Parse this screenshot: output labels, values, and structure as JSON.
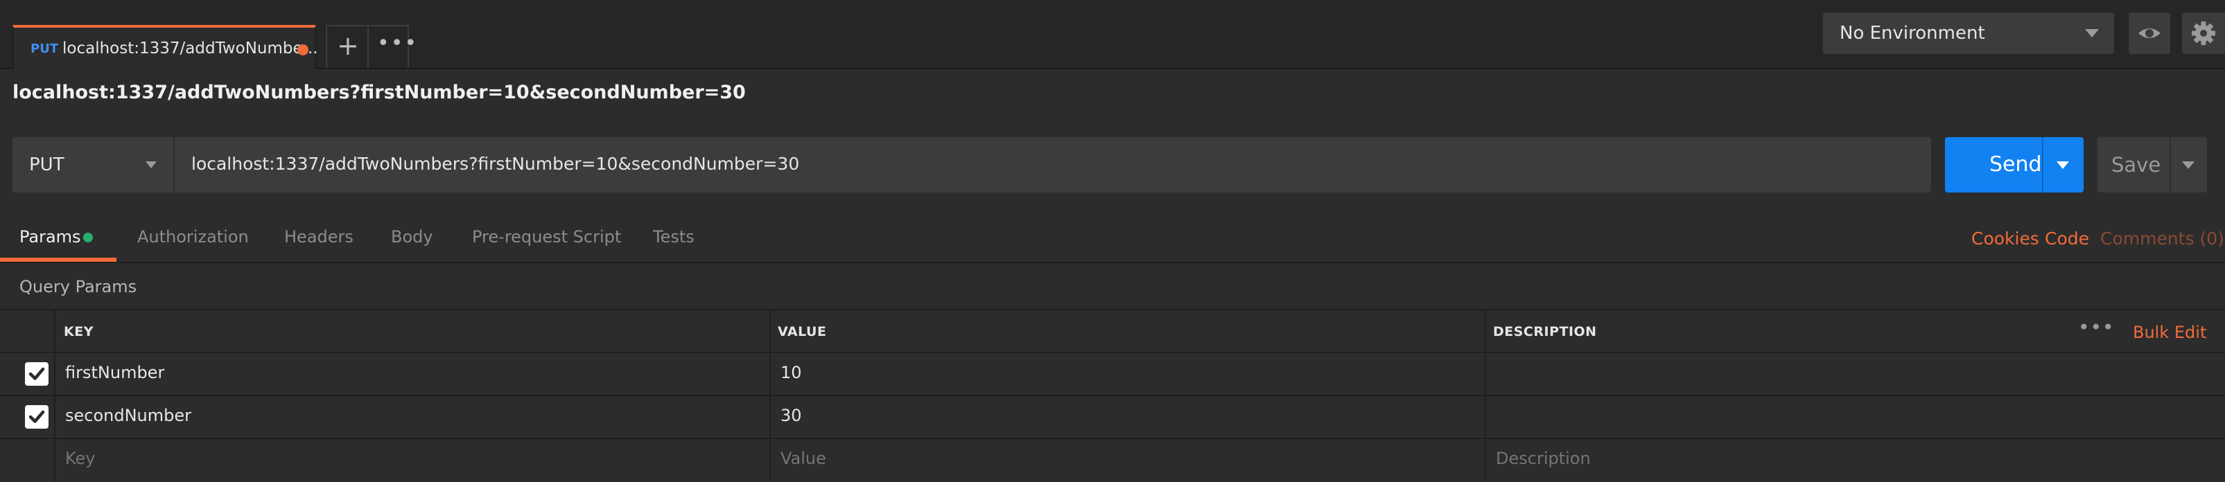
{
  "tab": {
    "method": "PUT",
    "title": "localhost:1337/addTwoNumbe..."
  },
  "environment": {
    "selected": "No Environment"
  },
  "request": {
    "title": "localhost:1337/addTwoNumbers?firstNumber=10&secondNumber=30",
    "method": "PUT",
    "url": "localhost:1337/addTwoNumbers?firstNumber=10&secondNumber=30",
    "send_label": "Send",
    "save_label": "Save"
  },
  "section_tabs": [
    {
      "label": "Params",
      "active": true
    },
    {
      "label": "Authorization"
    },
    {
      "label": "Headers"
    },
    {
      "label": "Body"
    },
    {
      "label": "Pre-request Script"
    },
    {
      "label": "Tests"
    }
  ],
  "right_links": {
    "cookies": "Cookies",
    "code": "Code",
    "comments": "Comments (0)"
  },
  "query_params": {
    "label": "Query Params",
    "headers": {
      "key": "KEY",
      "value": "VALUE",
      "description": "DESCRIPTION"
    },
    "bulk_edit": "Bulk Edit",
    "rows": [
      {
        "checked": true,
        "key": "firstNumber",
        "value": "10",
        "description": ""
      },
      {
        "checked": true,
        "key": "secondNumber",
        "value": "30",
        "description": ""
      }
    ],
    "placeholders": {
      "key": "Key",
      "value": "Value",
      "description": "Description"
    }
  },
  "icons": {
    "add_tab": "plus-icon",
    "more": "ellipsis-icon",
    "env_quick_look": "eye-icon",
    "settings": "gear-icon",
    "checkbox": "checkmark-icon"
  },
  "colors": {
    "accent": "#f26b3a",
    "send": "#1281f2",
    "method_put": "#3f8ef2",
    "params_dot": "#27b06e",
    "background": "#2c2c2c"
  }
}
